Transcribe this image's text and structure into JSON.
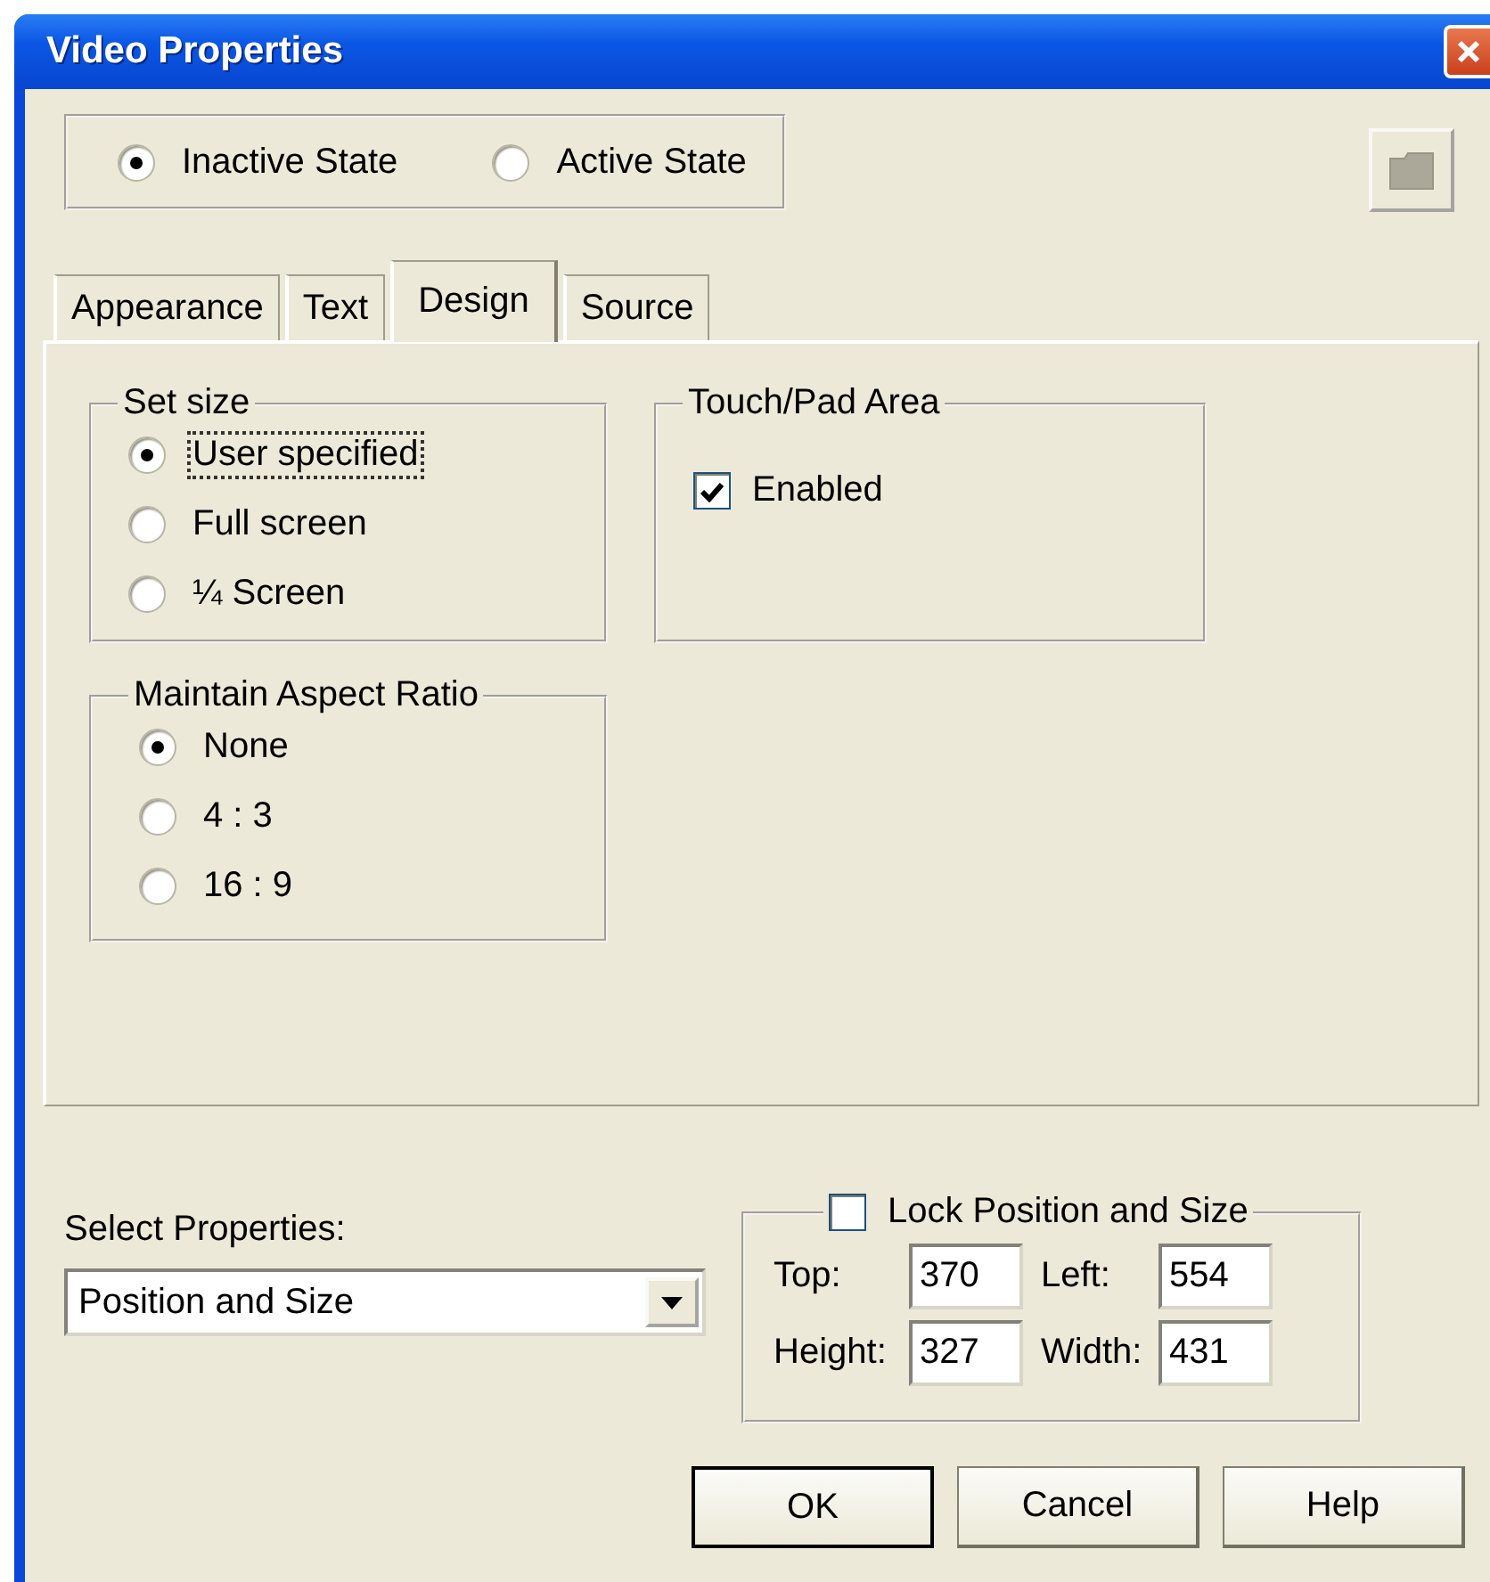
{
  "window": {
    "title": "Video Properties"
  },
  "state_options": [
    {
      "label": "Inactive State",
      "selected": true
    },
    {
      "label": "Active State",
      "selected": false
    }
  ],
  "tabs": [
    {
      "label": "Appearance",
      "selected": false
    },
    {
      "label": "Text",
      "selected": false
    },
    {
      "label": "Design",
      "selected": true
    },
    {
      "label": "Source",
      "selected": false
    }
  ],
  "set_size": {
    "title": "Set size",
    "options": [
      {
        "label": "User specified",
        "selected": true,
        "focused": true
      },
      {
        "label": "Full screen",
        "selected": false,
        "focused": false
      },
      {
        "label": "¼ Screen",
        "selected": false,
        "focused": false
      }
    ]
  },
  "touch_pad_area": {
    "title": "Touch/Pad Area",
    "checkbox": {
      "label": "Enabled",
      "checked": true
    }
  },
  "aspect_ratio": {
    "title": "Maintain Aspect Ratio",
    "options": [
      {
        "label": "None",
        "selected": true,
        "focused": false
      },
      {
        "label": "4 : 3",
        "selected": false,
        "focused": false
      },
      {
        "label": "16 : 9",
        "selected": false,
        "focused": false
      }
    ]
  },
  "select_properties": {
    "label": "Select Properties:",
    "value": "Position and Size"
  },
  "lock": {
    "label": "Lock Position and Size",
    "checked": false,
    "fields": [
      {
        "label": "Top:",
        "value": "370"
      },
      {
        "label": "Left:",
        "value": "554"
      },
      {
        "label": "Height:",
        "value": "327"
      },
      {
        "label": "Width:",
        "value": "431"
      }
    ]
  },
  "buttons": [
    {
      "label": "OK",
      "default": true
    },
    {
      "label": "Cancel",
      "default": false
    },
    {
      "label": "Help",
      "default": false
    }
  ]
}
